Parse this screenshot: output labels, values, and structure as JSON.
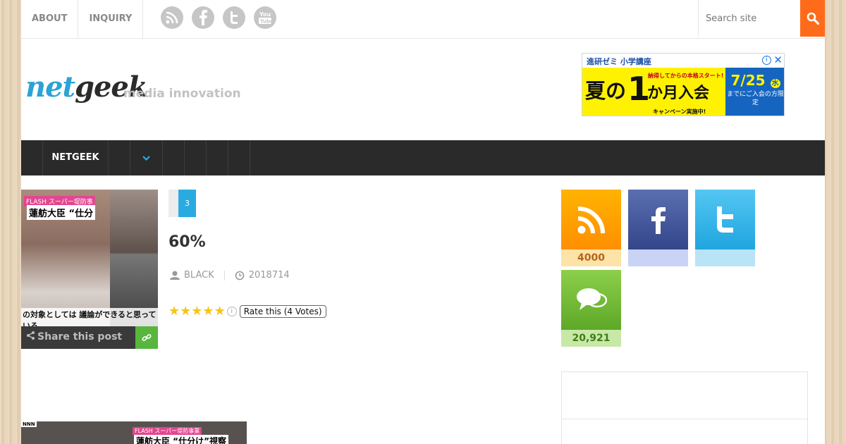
{
  "topnav": {
    "items": [
      "ABOUT",
      "INQUIRY"
    ]
  },
  "social": [
    "rss-icon",
    "facebook-icon",
    "twitter-icon",
    "youtube-icon"
  ],
  "search": {
    "placeholder": "Search site"
  },
  "header": {
    "logo_net": "net",
    "logo_geek": "geek",
    "tagline": "media innovation"
  },
  "ad": {
    "title": "進研ゼミ 小学講座",
    "main": "夏の",
    "number": "1",
    "main2": "か月入会",
    "sub": "納得してからの本格スタート!",
    "sub2": "キャンペーン実施中!",
    "date": "7/25",
    "day": "水",
    "right_text": "までにご入会の方限定"
  },
  "mainnav": {
    "home": "NETGEEK"
  },
  "thumbnail": {
    "caption1": "FLASH スーパー堤防事",
    "caption2": "蓮舫大臣 “仕分",
    "caption3": "の対象としては 議論ができると思っている"
  },
  "share": {
    "label": "Share this post"
  },
  "post": {
    "comment_count": "3",
    "title": "60%",
    "author": "BLACK",
    "date": "2018714",
    "rating_stars": 5,
    "rating_label": "Rate this (4 Votes)"
  },
  "sidebar": {
    "rss_count": "4000",
    "facebook_count": "",
    "twitter_count": "",
    "comments_count": "20,921"
  },
  "bottom_image": {
    "logo": "NNN",
    "caption1": "FLASH スーパー堤防事業",
    "caption2": "蓮舫大臣 “仕分け”視察"
  }
}
